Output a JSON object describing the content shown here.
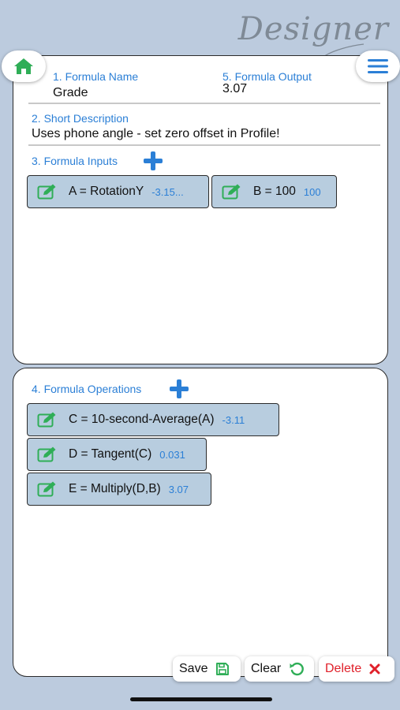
{
  "brand": "Designer",
  "formula": {
    "name_label": "1. Formula Name",
    "name_value": "Grade",
    "output_label": "5. Formula Output",
    "output_value": "3.07",
    "description_label": "2. Short Description",
    "description_value": "Uses phone angle - set zero offset in Profile!",
    "inputs_label": "3. Formula Inputs",
    "operations_label": "4. Formula Operations"
  },
  "inputs": [
    {
      "text": "A = RotationY",
      "value": "-3.15..."
    },
    {
      "text": "B = 100",
      "value": "100"
    }
  ],
  "operations": [
    {
      "text": "C = 10-second-Average(A)",
      "value": "-3.11"
    },
    {
      "text": "D = Tangent(C)",
      "value": "0.031"
    },
    {
      "text": "E = Multiply(D,B)",
      "value": "3.07"
    }
  ],
  "actions": {
    "save": "Save",
    "clear": "Clear",
    "delete": "Delete"
  },
  "colors": {
    "background": "#bccbde",
    "label_blue": "#2b7fd6",
    "chip_fill": "#b8cddf",
    "icon_green": "#2fae57",
    "delete_red": "#e0202a"
  },
  "icons": {
    "home": "home-icon",
    "menu": "hamburger-menu-icon",
    "add": "plus-icon",
    "edit": "edit-icon",
    "save": "floppy-disk-icon",
    "clear": "refresh-icon",
    "delete": "close-icon"
  }
}
